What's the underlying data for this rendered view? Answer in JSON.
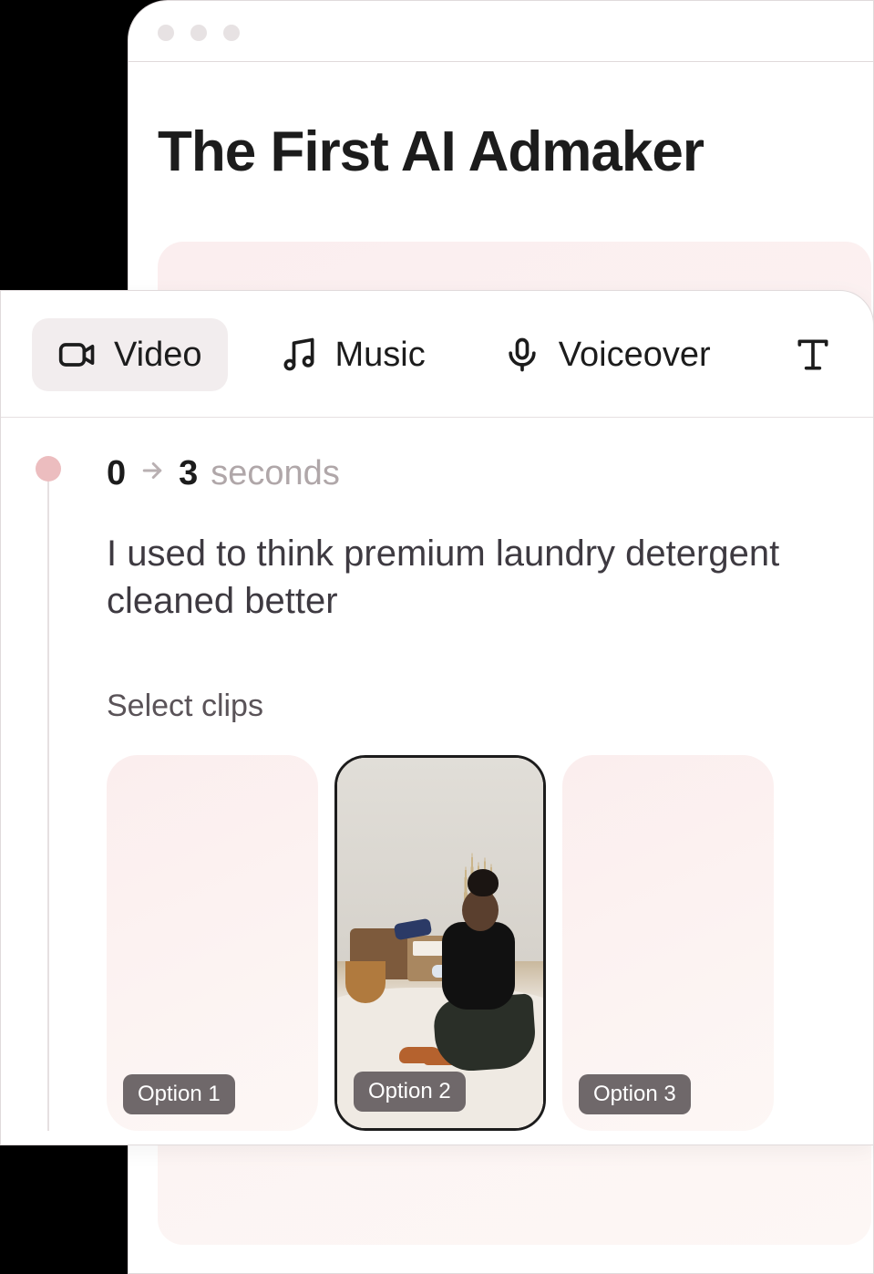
{
  "hero": {
    "title": "The First AI Admaker"
  },
  "tabs": {
    "video": "Video",
    "music": "Music",
    "voiceover": "Voiceover"
  },
  "segment": {
    "start": "0",
    "end": "3",
    "unit": "seconds",
    "script": "I used to think premium laundry detergent cleaned better",
    "select_label": "Select clips"
  },
  "clips": [
    {
      "label": "Option 1"
    },
    {
      "label": "Option 2"
    },
    {
      "label": "Option 3"
    }
  ]
}
